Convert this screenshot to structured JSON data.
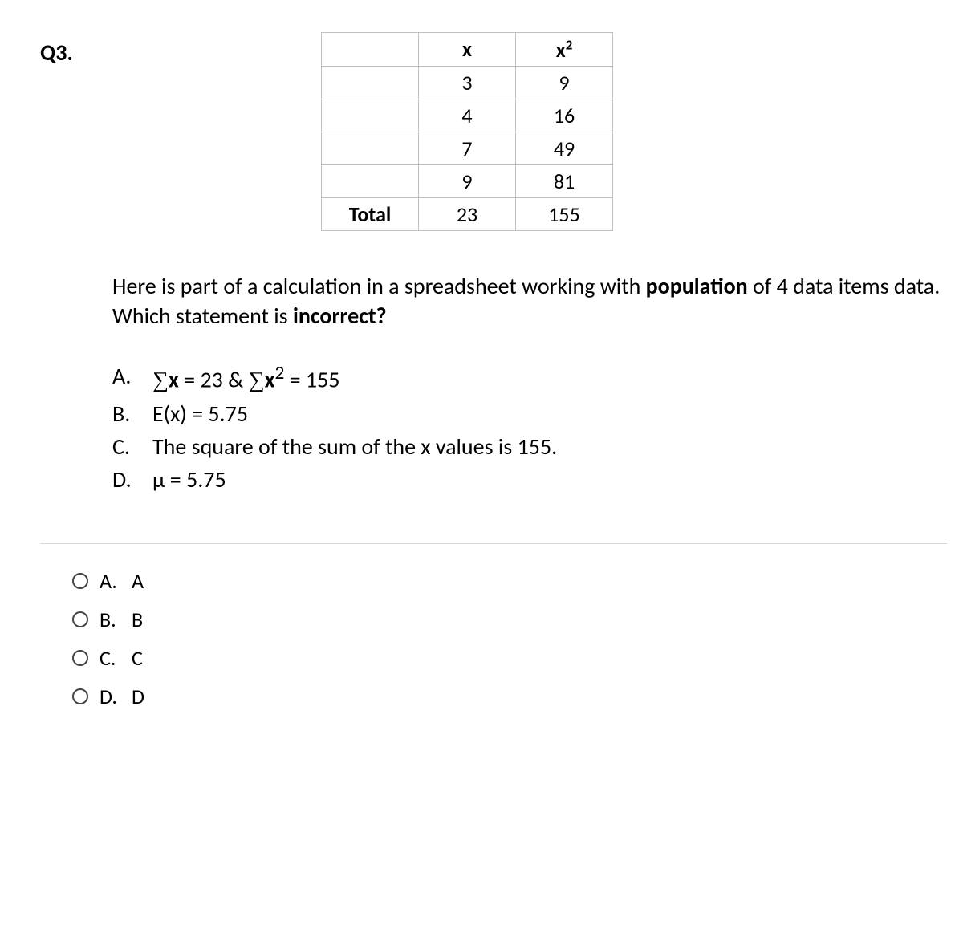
{
  "question_number": "Q3.",
  "table": {
    "headers": {
      "c1": "",
      "c2": "x",
      "c3_base": "x",
      "c3_sup": "2"
    },
    "rows": [
      {
        "c1": "",
        "c2": "3",
        "c3": "9"
      },
      {
        "c1": "",
        "c2": "4",
        "c3": "16"
      },
      {
        "c1": "",
        "c2": "7",
        "c3": "49"
      },
      {
        "c1": "",
        "c2": "9",
        "c3": "81"
      }
    ],
    "total": {
      "label": "Total",
      "c2": "23",
      "c3": "155"
    }
  },
  "prompt": {
    "p1": "Here is part of a calculation in a spreadsheet working with ",
    "b1": "population",
    "p2": " of 4 data items data. Which statement is ",
    "b2": "incorrect?"
  },
  "options": {
    "A": {
      "letter": "A.",
      "pre": "∑",
      "x1": "x",
      "mid": " = 23 & ",
      "pre2": "∑",
      "x2": "x",
      "sup": "2",
      "post": " = 155"
    },
    "B": {
      "letter": "B.",
      "text": "E(x) = 5.75"
    },
    "C": {
      "letter": "C.",
      "text": "The square of the sum of the x values is 155."
    },
    "D": {
      "letter": "D.",
      "text": "μ = 5.75"
    }
  },
  "answers": {
    "A": {
      "letter": "A.",
      "value": "A"
    },
    "B": {
      "letter": "B.",
      "value": "B"
    },
    "C": {
      "letter": "C.",
      "value": "C"
    },
    "D": {
      "letter": "D.",
      "value": "D"
    }
  }
}
